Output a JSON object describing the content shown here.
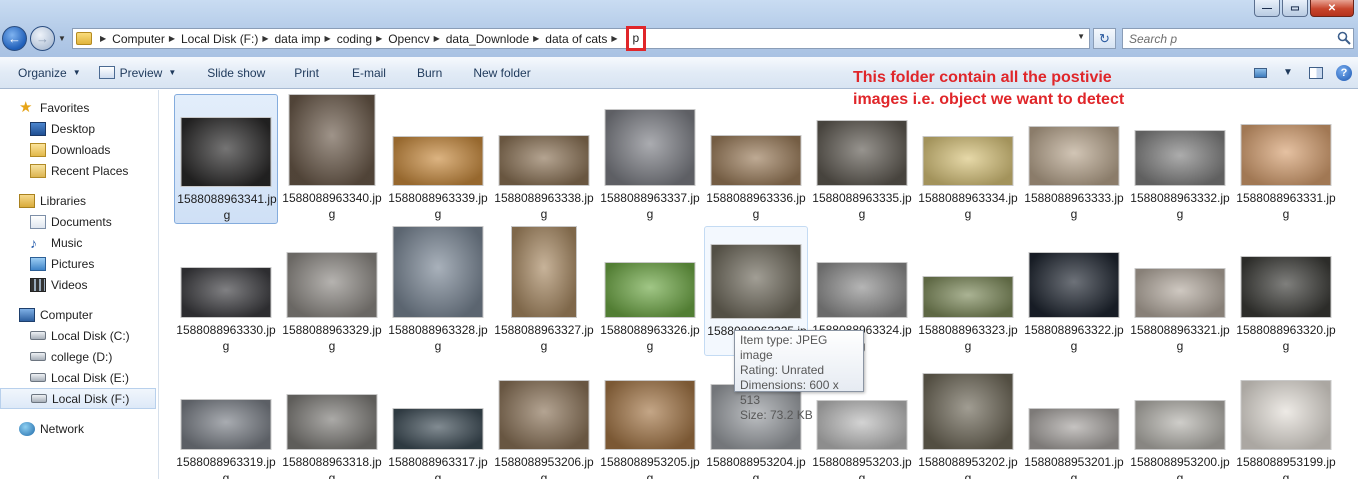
{
  "window": {
    "minimize_glyph": "—",
    "maximize_glyph": "▭",
    "close_glyph": "✕"
  },
  "address": {
    "crumbs": [
      "Computer",
      "Local Disk (F:)",
      "data imp",
      "coding",
      "Opencv",
      "data_Downlode",
      "data of cats"
    ],
    "current": "p"
  },
  "search": {
    "placeholder": "Search p"
  },
  "toolbar": {
    "organize": "Organize",
    "preview": "Preview",
    "slideshow": "Slide show",
    "print": "Print",
    "email": "E-mail",
    "burn": "Burn",
    "new_folder": "New folder",
    "help": "?"
  },
  "sidebar": {
    "favorites": {
      "label": "Favorites",
      "items": [
        "Desktop",
        "Downloads",
        "Recent Places"
      ]
    },
    "libraries": {
      "label": "Libraries",
      "items": [
        "Documents",
        "Music",
        "Pictures",
        "Videos"
      ]
    },
    "computer": {
      "label": "Computer",
      "items": [
        "Local Disk (C:)",
        "college (D:)",
        "Local Disk (E:)",
        "Local Disk (F:)"
      ]
    },
    "network": {
      "label": "Network"
    }
  },
  "annotation": {
    "line1": "This folder contain all the postivie",
    "line2": "images i.e. object we want to detect"
  },
  "files": [
    [
      "1588088963341.jpg",
      "1588088963340.jpg",
      "1588088963339.jpg",
      "1588088963338.jpg",
      "1588088963337.jpg",
      "1588088963336.jpg",
      "1588088963335.jpg",
      "1588088963334.jpg",
      "1588088963333.jpg",
      "1588088963332.jpg",
      "1588088963331.jpg"
    ],
    [
      "1588088963330.jpg",
      "1588088963329.jpg",
      "1588088963328.jpg",
      "1588088963327.jpg",
      "1588088963326.jpg",
      "1588088963325.jpg",
      "1588088963324.jpg",
      "1588088963323.jpg",
      "1588088963322.jpg",
      "1588088963321.jpg",
      "1588088963320.jpg"
    ],
    [
      "1588088963319.jpg",
      "1588088963318.jpg",
      "1588088963317.jpg",
      "1588088953206.jpg",
      "1588088953205.jpg",
      "1588088953204.jpg",
      "1588088953203.jpg",
      "1588088953202.jpg",
      "1588088953201.jpg",
      "1588088953200.jpg",
      "1588088953199.jpg"
    ]
  ],
  "thumb_colors": [
    [
      "#2b2a2a",
      "#6b5a4a",
      "#c98b3e",
      "#8c7356",
      "#7d7f86",
      "#9b7c5a",
      "#5f5a52",
      "#d9c47a",
      "#b9a68e",
      "#808080",
      "#d7a070"
    ],
    [
      "#3c3c40",
      "#8e8a85",
      "#7a8796",
      "#a98a63",
      "#6ea845",
      "#6f6a5c",
      "#8e8e8e",
      "#7d8a5a",
      "#1f2631",
      "#b5aba0",
      "#3b3b37"
    ],
    [
      "#7a7f87",
      "#7e7c78",
      "#3e4d57",
      "#8b7358",
      "#a47646",
      "#9a9ea3",
      "#bcbcbc",
      "#6e6858",
      "#a7a3a0",
      "#b5b3ad",
      "#e4dfd8"
    ]
  ],
  "tooltip": {
    "type": "Item type: JPEG image",
    "rating": "Rating: Unrated",
    "dimensions": "Dimensions: 600 x 513",
    "size": "Size: 73.2 KB"
  }
}
